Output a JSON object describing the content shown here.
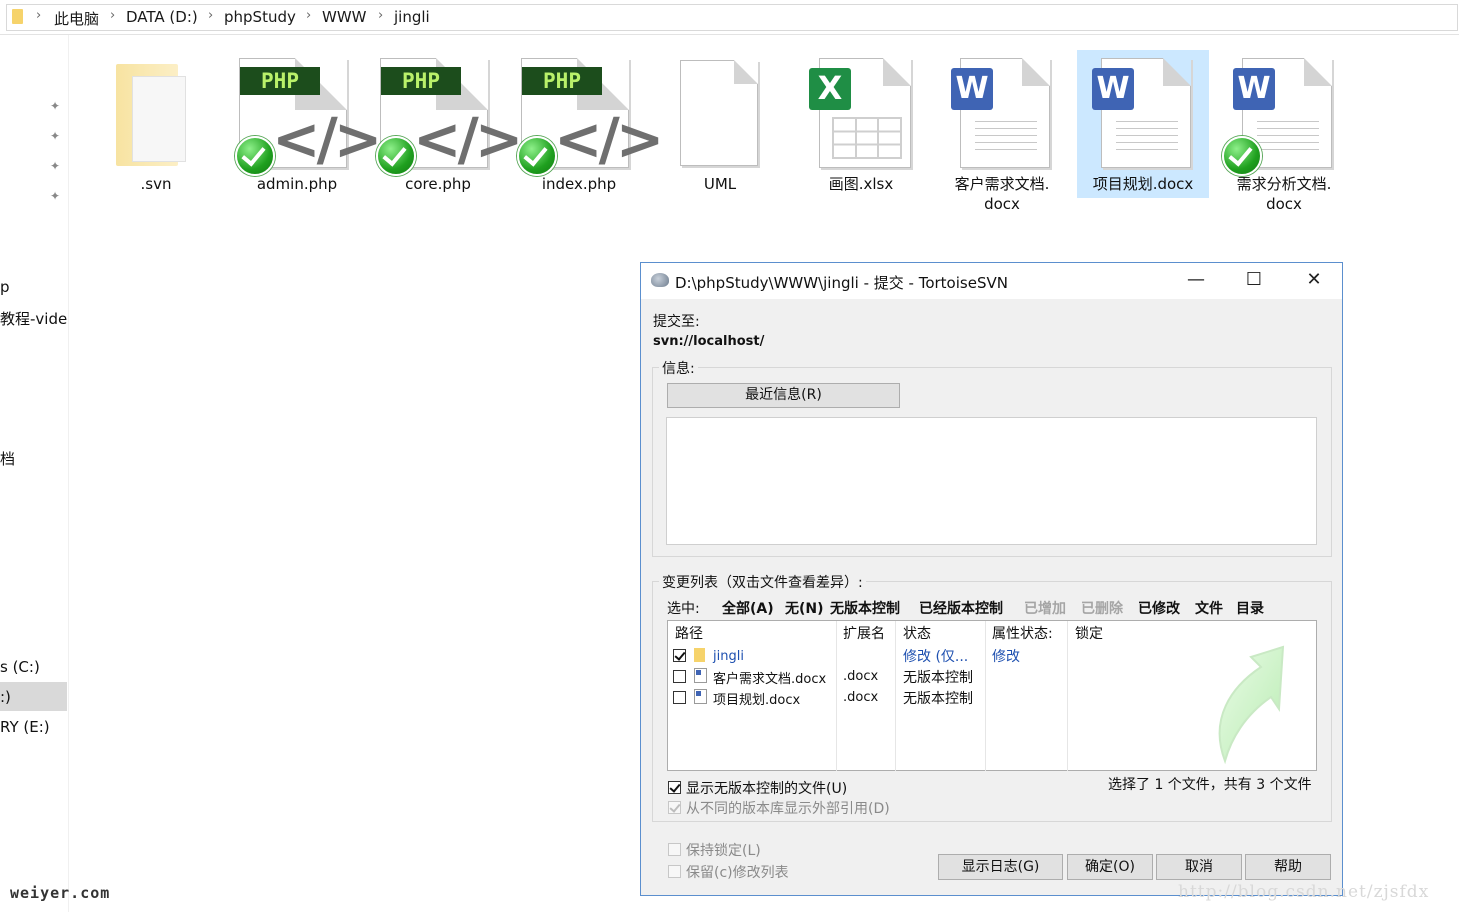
{
  "breadcrumb": {
    "items": [
      "此电脑",
      "DATA (D:)",
      "phpStudy",
      "WWW",
      "jingli"
    ]
  },
  "nav": {
    "items": [
      "p",
      "教程-vide",
      "档",
      "s (C:)",
      ":)",
      "RY (E:)"
    ]
  },
  "files": [
    {
      "name": ".svn",
      "type": "folder",
      "synced": false
    },
    {
      "name": "admin.php",
      "type": "php",
      "synced": true,
      "badge": "PHP"
    },
    {
      "name": "core.php",
      "type": "php",
      "synced": true,
      "badge": "PHP"
    },
    {
      "name": "index.php",
      "type": "php",
      "synced": true,
      "badge": "PHP"
    },
    {
      "name": "UML",
      "type": "blank",
      "synced": false
    },
    {
      "name": "画图.xlsx",
      "type": "xlsx",
      "synced": false,
      "badge": "X"
    },
    {
      "name": "客户需求文档.docx",
      "line1": "客户需求文档.",
      "line2": "docx",
      "type": "wps",
      "synced": false,
      "badge": "W"
    },
    {
      "name": "项目规划.docx",
      "type": "wps",
      "synced": false,
      "selected": true,
      "badge": "W"
    },
    {
      "name": "需求分析文档.docx",
      "line1": "需求分析文档.",
      "line2": "docx",
      "type": "wps",
      "synced": true,
      "badge": "W"
    }
  ],
  "dialog": {
    "title": "D:\\phpStudy\\WWW\\jingli - 提交 - TortoiseSVN",
    "commit_to_label": "提交至:",
    "commit_url": "svn://localhost/",
    "message_group": "信息:",
    "recent_messages_button": "最近信息(R)",
    "message_text": "",
    "changes_group": "变更列表（双击文件查看差异）:",
    "select_label": "选中:",
    "select_filters": [
      {
        "label": "全部(A)",
        "enabled": true
      },
      {
        "label": "无(N)",
        "enabled": true
      },
      {
        "label": "无版本控制",
        "enabled": true
      },
      {
        "label": "已经版本控制",
        "enabled": true
      },
      {
        "label": "已增加",
        "enabled": false
      },
      {
        "label": "已删除",
        "enabled": false
      },
      {
        "label": "已修改",
        "enabled": true
      },
      {
        "label": "文件",
        "enabled": true
      },
      {
        "label": "目录",
        "enabled": true
      }
    ],
    "columns": [
      "路径",
      "扩展名",
      "状态",
      "属性状态:",
      "锁定"
    ],
    "rows": [
      {
        "checked": true,
        "path": "jingli",
        "ext": "",
        "status": "修改 (仅...",
        "prop_status": "修改",
        "lock": "",
        "kind": "folder"
      },
      {
        "checked": false,
        "path": "客户需求文档.docx",
        "ext": ".docx",
        "status": "无版本控制",
        "prop_status": "",
        "lock": "",
        "kind": "file"
      },
      {
        "checked": false,
        "path": "项目规划.docx",
        "ext": ".docx",
        "status": "无版本控制",
        "prop_status": "",
        "lock": "",
        "kind": "file"
      }
    ],
    "selection_summary": "选择了 1 个文件，共有 3 个文件",
    "show_unversioned": {
      "label": "显示无版本控制的文件(U)",
      "checked": true
    },
    "show_externals": {
      "label": "从不同的版本库显示外部引用(D)",
      "checked": true,
      "enabled": false
    },
    "keep_locks": {
      "label": "保持锁定(L)",
      "checked": false
    },
    "keep_changelist": {
      "label": "保留(c)修改列表",
      "checked": false
    },
    "buttons": {
      "show_log": "显示日志(G)",
      "ok": "确定(O)",
      "cancel": "取消",
      "help": "帮助"
    }
  },
  "watermarks": {
    "left": "weiyer.com",
    "right": "http://blog.csdn.net/zjsfdx"
  }
}
